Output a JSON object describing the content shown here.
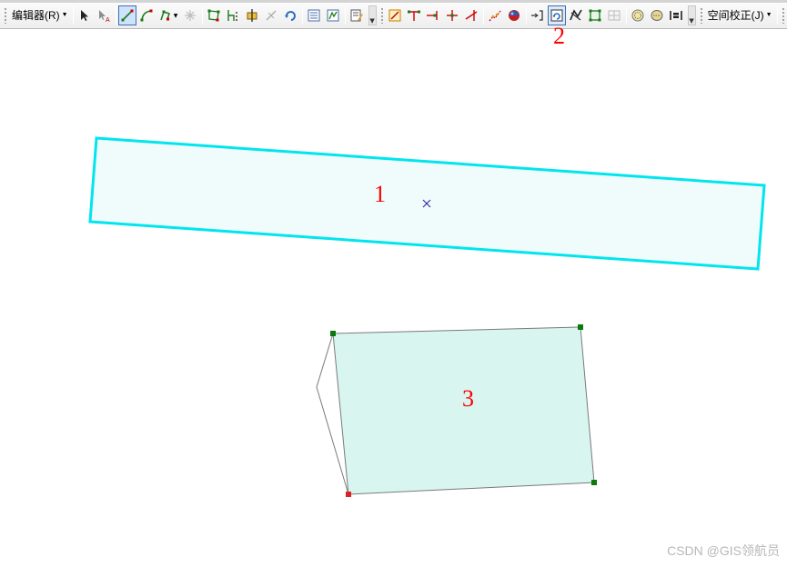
{
  "toolbar": {
    "editor_menu_label": "编辑器(R)",
    "spatial_adjust_menu_label": "空间校正(J)",
    "tools": [
      "edit-tool-icon",
      "edit-annotation-icon",
      "straight-segment-icon",
      "arc-segment-icon",
      "trace-tool-icon",
      "point-icon",
      "edit-vertices-icon",
      "reshape-feature-icon",
      "cut-polygons-icon",
      "split-tool-icon",
      "rotate-tool-icon",
      "attributes-icon",
      "sketch-properties-icon",
      "create-features-icon",
      "topology-edit-icon",
      "align-to-shape-icon",
      "extend-icon",
      "trim-icon",
      "line-intersection-icon",
      "generalize-icon",
      "smooth-icon",
      "reshape-edge-icon",
      "construct-features-icon",
      "fillet-icon",
      "rectangle-icon",
      "grid-icon",
      "buffer-icon",
      "union-icon",
      "copy-parallel-icon"
    ]
  },
  "annotations": {
    "label_1": "1",
    "label_2": "2",
    "label_3": "3"
  },
  "colors": {
    "selected_outline": "#00e5ee",
    "selected_fill": "#f0fcfc",
    "polygon_fill": "#d8f5f0",
    "vertex_green": "#0a7a0a",
    "vertex_red": "#e02020",
    "annotation_red": "#ff0000",
    "centroid_blue": "#3333aa"
  },
  "watermark": "CSDN @GIS领航员"
}
